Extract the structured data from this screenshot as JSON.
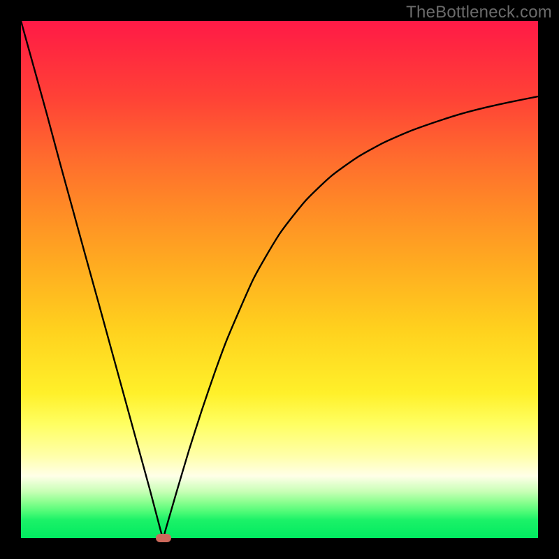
{
  "watermark": "TheBottleneck.com",
  "colors": {
    "background": "#000000",
    "curve": "#000000",
    "marker": "#cd6a5c"
  },
  "chart_data": {
    "type": "line",
    "title": "",
    "xlabel": "",
    "ylabel": "",
    "xlim": [
      0,
      100
    ],
    "ylim": [
      0,
      100
    ],
    "grid": false,
    "legend": false,
    "annotations": [],
    "series": [
      {
        "name": "curve",
        "x": [
          0,
          2.5,
          5,
          7.5,
          10,
          12.5,
          15,
          17.5,
          20,
          22.5,
          25,
          27,
          27.5,
          28,
          30,
          32.5,
          35,
          37.5,
          40,
          45,
          50,
          55,
          60,
          65,
          70,
          75,
          80,
          85,
          90,
          95,
          100
        ],
        "values": [
          100,
          91,
          82,
          72.7,
          63.6,
          54.5,
          45.5,
          36.4,
          27.3,
          18.2,
          9.1,
          1.5,
          0,
          1.7,
          8.6,
          17,
          24.8,
          32.1,
          38.8,
          50.2,
          58.8,
          65.2,
          70,
          73.6,
          76.4,
          78.6,
          80.4,
          82,
          83.3,
          84.4,
          85.4
        ]
      }
    ],
    "marker": {
      "x": 27.5,
      "y": 0,
      "color": "#cd6a5c"
    }
  }
}
